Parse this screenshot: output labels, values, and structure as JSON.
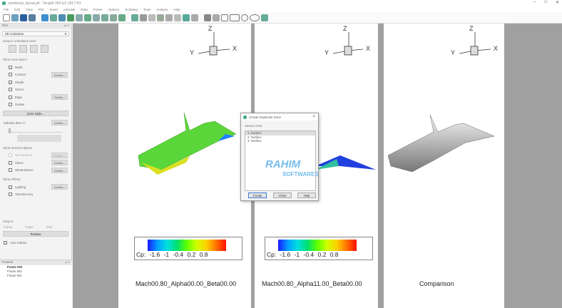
{
  "window": {
    "title": "combined_layout.plt - Tecplot 360 EX 2017 R1",
    "controls": [
      "–",
      "□",
      "✕"
    ]
  },
  "menu": [
    "File",
    "Edit",
    "View",
    "Plot",
    "Insert",
    "Animate",
    "Data",
    "Frame",
    "Options",
    "Scripting",
    "Tools",
    "Analyze",
    "Help"
  ],
  "left_panel": {
    "header": "Plot",
    "plot_type": "3D Cartesian",
    "snap_label": "Snap to orientation view:",
    "zone_layers_label": "Show zone layers",
    "layers": [
      {
        "label": "Mesh",
        "checked": false
      },
      {
        "label": "Contour",
        "checked": false,
        "details": "Details..."
      },
      {
        "label": "Shade",
        "checked": true
      },
      {
        "label": "Vector",
        "checked": false
      },
      {
        "label": "Edge",
        "checked": false,
        "details": "Details..."
      },
      {
        "label": "Scatter",
        "checked": false
      }
    ],
    "zone_style": "Zone Style...",
    "solution_time": "Solution time: 0",
    "solution_details": "Details...",
    "derived_label": "Show derived objects",
    "derived": [
      {
        "label": "Iso-Surfaces",
        "details": "Details..."
      },
      {
        "label": "Slices",
        "details": "Details..."
      },
      {
        "label": "Streamtraces",
        "details": "Details..."
      }
    ],
    "effects_label": "Show effects",
    "effects": [
      {
        "label": "Lighting",
        "checked": true,
        "details": "Details..."
      },
      {
        "label": "Translucency",
        "checked": false
      }
    ],
    "snap_to_label": "Snap to",
    "snap_to": [
      "Frame",
      "Paper",
      "Grid"
    ],
    "redraw": "Redraw",
    "auto_redraw": "Auto redraw"
  },
  "frames_panel": {
    "header": "Frames",
    "items": [
      "Frame 003",
      "Frame 002",
      "Frame 001"
    ]
  },
  "plots": [
    {
      "label": "Mach00.80_Alpha00.00_Beta00.00",
      "colorbar": "Cp:  -1.6  -1  -0.4  0.2  0.8"
    },
    {
      "label": "Mach00.80_Alpha11.00_Beta00.00",
      "colorbar": "Cp:  -1.6  -1  -0.4  0.2  0.8"
    },
    {
      "label": "Comparison"
    }
  ],
  "axes": {
    "x": "X",
    "y": "Y",
    "z": "Z"
  },
  "dialog": {
    "title": "Create Duplicate Zone",
    "source_label": "Source zone:",
    "zones": [
      "1: Surface",
      "2: Surface",
      "3: Surface"
    ],
    "buttons": [
      "Create",
      "Close",
      "Help"
    ]
  },
  "watermark": {
    "line1": "RAHIM",
    "line2": "SOFTWARES"
  }
}
